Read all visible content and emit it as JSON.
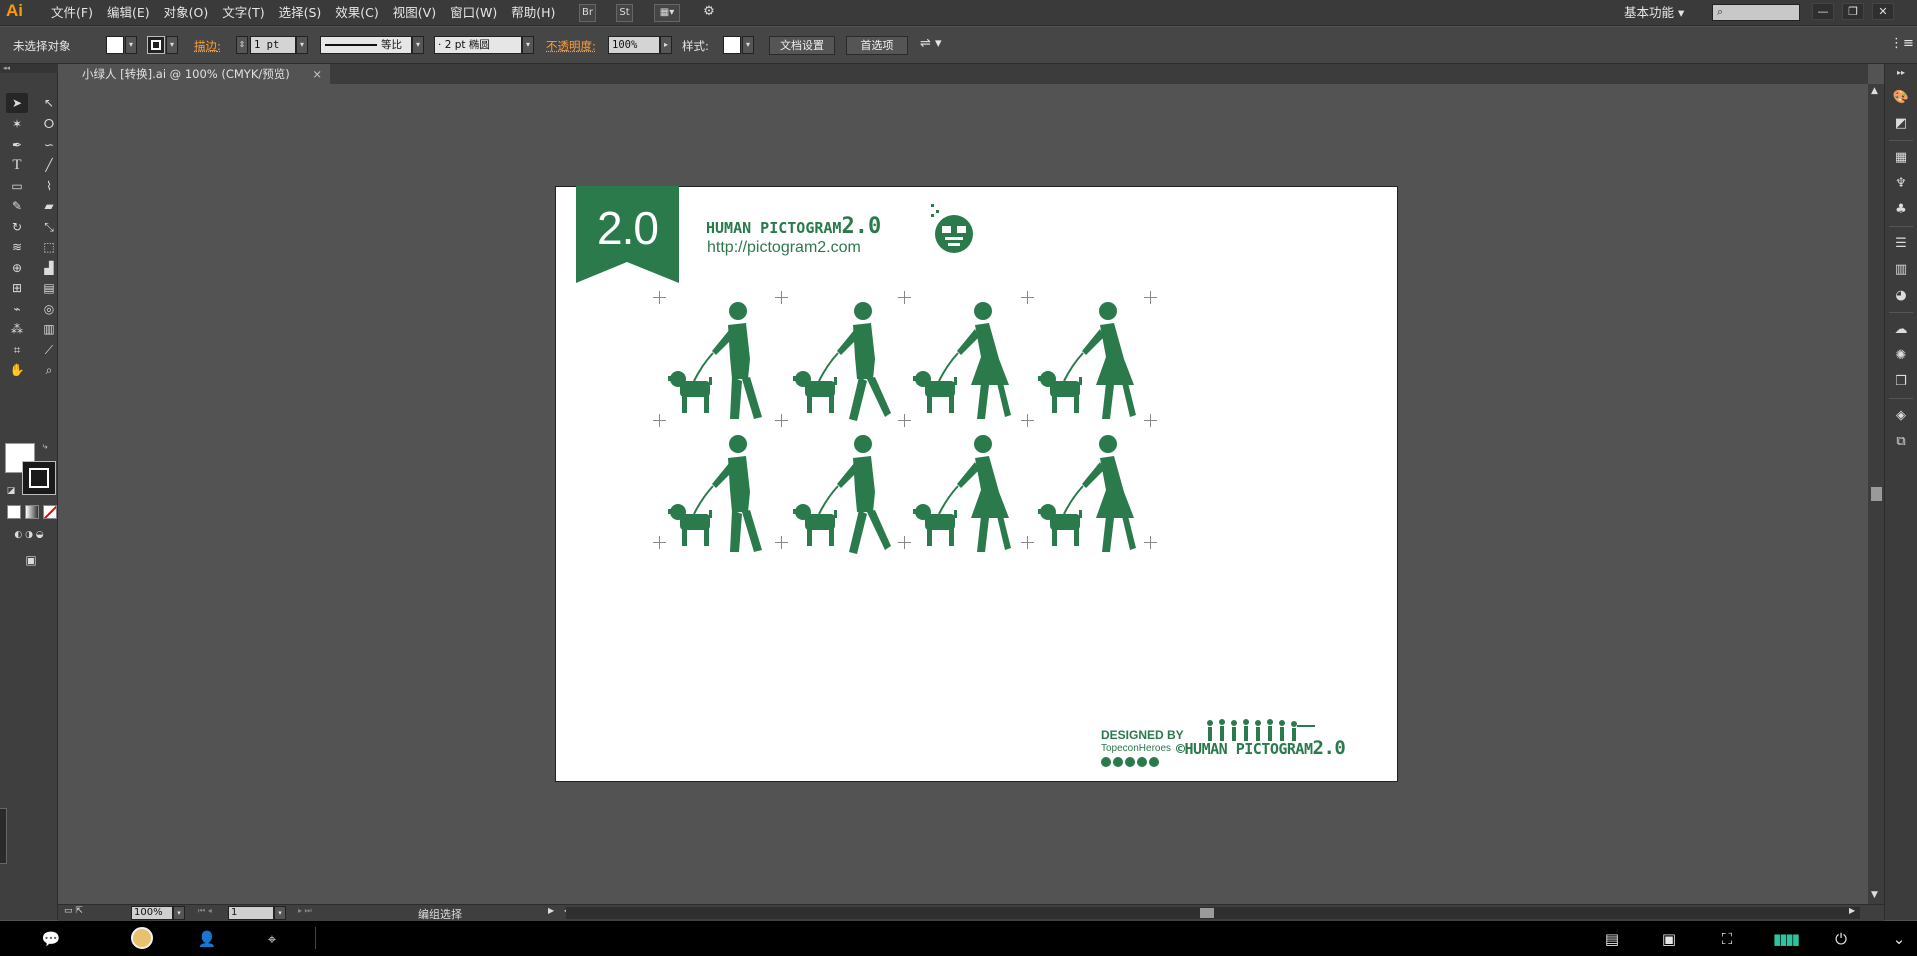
{
  "app": {
    "logo": "Ai"
  },
  "menubar": {
    "items": [
      "文件(F)",
      "编辑(E)",
      "对象(O)",
      "文字(T)",
      "选择(S)",
      "效果(C)",
      "视图(V)",
      "窗口(W)",
      "帮助(H)"
    ],
    "bridge_label": "Br",
    "stock_label": "St",
    "workspace": "基本功能",
    "window_controls": [
      "—",
      "❐",
      "✕"
    ]
  },
  "controlbar": {
    "selection_status": "未选择对象",
    "stroke_label": "描边",
    "stroke_weight": "1 pt",
    "stroke_profile": "等比",
    "brush_label": "2 pt 椭圆",
    "opacity_label": "不透明度",
    "opacity_value": "100%",
    "style_label": "样式",
    "doc_setup_button": "文档设置",
    "preferences_button": "首选项"
  },
  "document": {
    "tab_title": "小绿人 [转换].ai @ 100% (CMYK/预览)",
    "close": "×"
  },
  "artwork": {
    "colors": {
      "green": "#2a7a4c",
      "artboard": "#ffffff"
    },
    "banner_text": "2.0",
    "brand_title_prefix": "HUMAN PICTOGRAM",
    "brand_title_version": "2.0",
    "brand_url": "http://pictogram2.com",
    "pictograms": [
      {
        "row": 1,
        "pose": "man-walking-dog"
      },
      {
        "row": 1,
        "pose": "man-walking-dog-stride"
      },
      {
        "row": 1,
        "pose": "woman-walking-dog"
      },
      {
        "row": 1,
        "pose": "woman-walking-dog-skirt"
      },
      {
        "row": 2,
        "pose": "man-walking-dog"
      },
      {
        "row": 2,
        "pose": "man-walking-dog-stride"
      },
      {
        "row": 2,
        "pose": "woman-walking-dog"
      },
      {
        "row": 2,
        "pose": "woman-walking-dog-skirt"
      }
    ],
    "credit_designed": "DESIGNED BY",
    "credit_team": "TopeconHeroes",
    "copyright_prefix": "©HUMAN PICTOGRAM",
    "copyright_version": "2.0"
  },
  "statusbar": {
    "zoom": "100%",
    "artboard_number": "1",
    "tool_status": "编组选择"
  },
  "icons": {
    "toolbar": [
      "selection-icon",
      "direct-selection-icon",
      "magic-wand-icon",
      "lasso-icon",
      "pen-icon",
      "curvature-icon",
      "type-icon",
      "line-icon",
      "rectangle-icon",
      "paintbrush-icon",
      "pencil-icon",
      "eraser-icon",
      "rotate-icon",
      "scale-icon",
      "warp-icon",
      "free-transform-icon",
      "shape-builder-icon",
      "perspective-icon",
      "mesh-icon",
      "gradient-icon",
      "eyedropper-icon",
      "blend-icon",
      "symbol-sprayer-icon",
      "column-graph-icon",
      "artboard-icon",
      "slice-icon",
      "hand-icon",
      "zoom-icon"
    ],
    "rightdock": [
      "color-icon",
      "color-guide-icon",
      "swatches-icon",
      "brushes-icon",
      "symbols-icon",
      "stroke-icon",
      "gradient-icon",
      "transparency-icon",
      "cc-libraries-icon",
      "appearance-icon",
      "graphic-styles-icon",
      "layers-icon",
      "artboards-icon"
    ]
  }
}
